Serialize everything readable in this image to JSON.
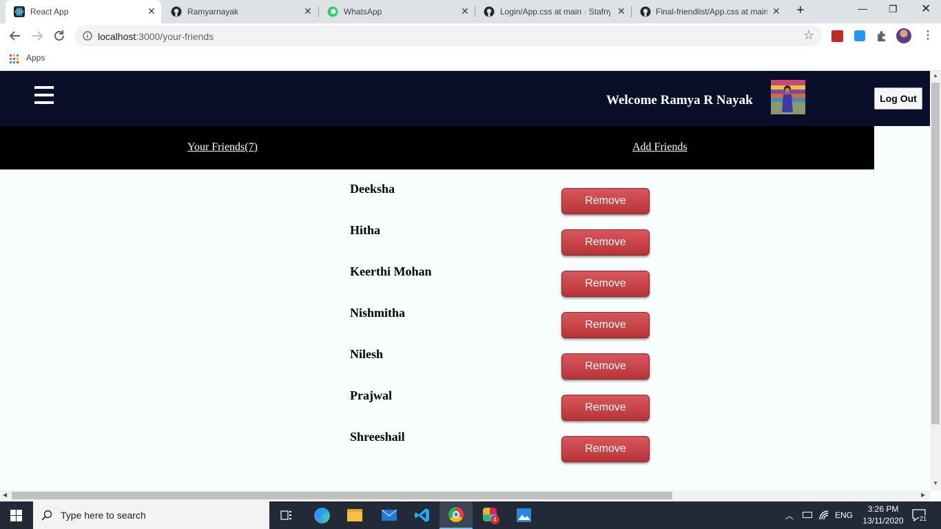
{
  "browser": {
    "tabs": [
      {
        "label": "React App",
        "active": true
      },
      {
        "label": "Ramyarnayak",
        "active": false
      },
      {
        "label": "WhatsApp",
        "active": false
      },
      {
        "label": "Login/App.css at main · Stafny\\",
        "active": false
      },
      {
        "label": "Final-friendlist/App.css at main",
        "active": false
      }
    ],
    "url_host": "localhost",
    "url_path": ":3000/your-friends",
    "bookmarks_apps_label": "Apps"
  },
  "header": {
    "welcome": "Welcome Ramya R Nayak",
    "logout_label": "Log Out"
  },
  "subnav": {
    "your_friends": "Your Friends(7)",
    "add_friends": "Add Friends"
  },
  "friends": [
    {
      "name": "Deeksha",
      "action": "Remove"
    },
    {
      "name": "Hitha",
      "action": "Remove"
    },
    {
      "name": "Keerthi Mohan",
      "action": "Remove"
    },
    {
      "name": "Nishmitha",
      "action": "Remove"
    },
    {
      "name": "Nilesh",
      "action": "Remove"
    },
    {
      "name": "Prajwal",
      "action": "Remove"
    },
    {
      "name": "Shreeshail",
      "action": "Remove"
    }
  ],
  "taskbar": {
    "search_placeholder": "Type here to search",
    "lang": "ENG",
    "time": "3:26 PM",
    "date": "13/11/2020",
    "notifications": "21",
    "slack_badge": "4"
  },
  "colors": {
    "header_bg": "#0a0f29",
    "subnav_bg": "#000000",
    "remove_button": "#c0393d",
    "page_bg": "#f8fdfd"
  }
}
